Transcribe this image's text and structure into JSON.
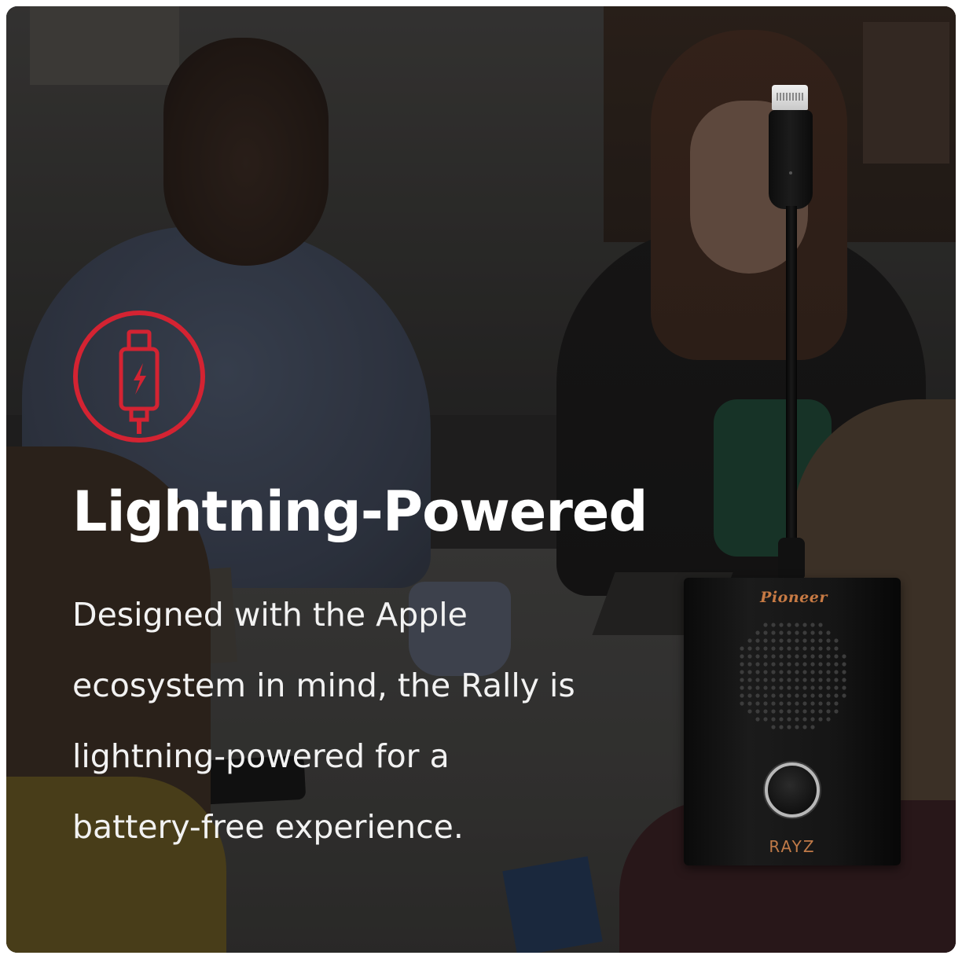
{
  "headline": "Lightning-Powered",
  "body_lines": [
    "Designed with the Apple",
    "ecosystem in mind, the Rally is",
    "lightning-powered for a",
    "battery-free experience."
  ],
  "product": {
    "brand": "Pioneer",
    "model": "RAYZ"
  },
  "icons": {
    "feature_icon": "lightning-cable-icon"
  },
  "colors": {
    "accent": "#d42332",
    "text": "#ffffff",
    "brand": "#c77a44"
  }
}
